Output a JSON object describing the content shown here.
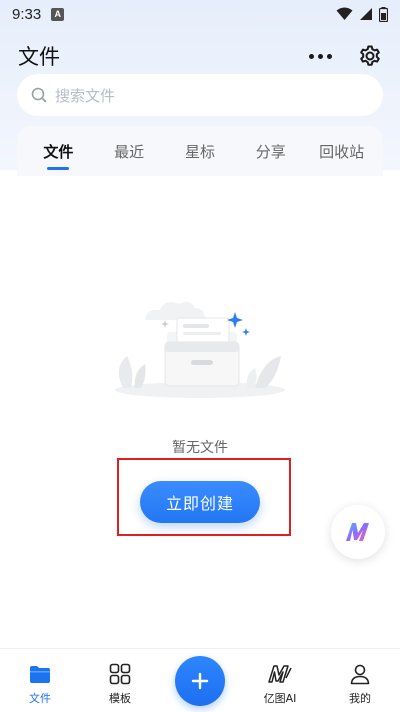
{
  "status_bar": {
    "time": "9:33",
    "notification_letter": "A"
  },
  "header": {
    "title": "文件"
  },
  "search": {
    "placeholder": "搜索文件"
  },
  "tabs": [
    {
      "label": "文件",
      "active": true
    },
    {
      "label": "最近",
      "active": false
    },
    {
      "label": "星标",
      "active": false
    },
    {
      "label": "分享",
      "active": false
    },
    {
      "label": "回收站",
      "active": false
    }
  ],
  "empty_state": {
    "message": "暂无文件",
    "create_label": "立即创建"
  },
  "bottom_nav": [
    {
      "label": "文件",
      "icon": "folder-icon",
      "active": true
    },
    {
      "label": "模板",
      "icon": "template-grid-icon",
      "active": false
    },
    {
      "label": "",
      "icon": "plus-icon",
      "active": false
    },
    {
      "label": "亿图AI",
      "icon": "edraw-ai-icon",
      "active": false
    },
    {
      "label": "我的",
      "icon": "profile-icon",
      "active": false
    }
  ],
  "colors": {
    "accent": "#1e73f0",
    "highlight_box": "#e02020"
  }
}
